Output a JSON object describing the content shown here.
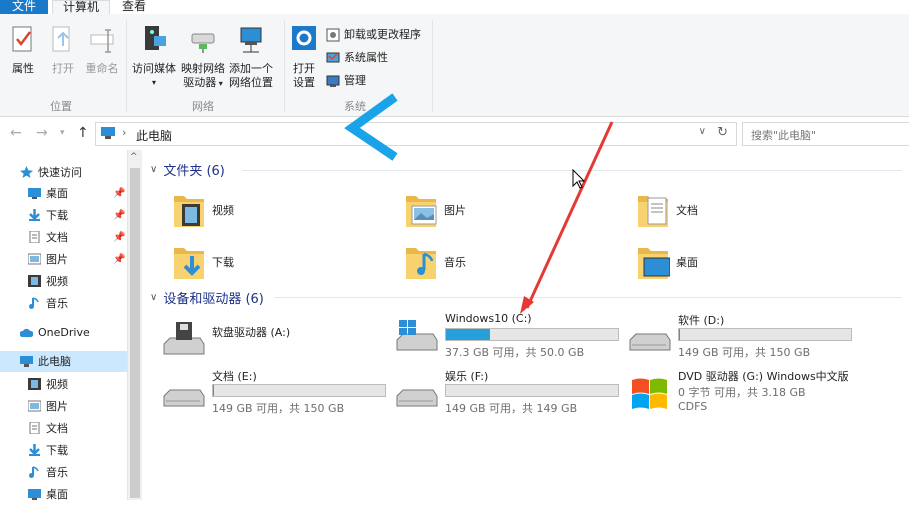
{
  "tabs": {
    "file": "文件",
    "computer": "计算机",
    "view": "查看"
  },
  "ribbon": {
    "properties": "属性",
    "open": "打开",
    "rename": "重命名",
    "group_location": "位置",
    "access_media": "访问媒体",
    "map_drive_l1": "映射网络",
    "map_drive_l2": "驱动器",
    "add_location_l1": "添加一个",
    "add_location_l2": "网络位置",
    "group_network": "网络",
    "open_settings_l1": "打开",
    "open_settings_l2": "设置",
    "uninstall": "卸载或更改程序",
    "system_props": "系统属性",
    "manage": "管理",
    "group_system": "系统"
  },
  "address": {
    "path": "此电脑",
    "search_placeholder": "搜索\"此电脑\""
  },
  "sidebar": [
    {
      "label": "快速访问",
      "icon": "star-icon",
      "pin": false
    },
    {
      "label": "桌面",
      "icon": "desktop-icon",
      "pin": true
    },
    {
      "label": "下载",
      "icon": "download-icon",
      "pin": true
    },
    {
      "label": "文档",
      "icon": "document-icon",
      "pin": true
    },
    {
      "label": "图片",
      "icon": "picture-icon",
      "pin": true
    },
    {
      "label": "视频",
      "icon": "video-icon",
      "pin": false
    },
    {
      "label": "音乐",
      "icon": "music-icon",
      "pin": false
    },
    {
      "label": "OneDrive",
      "icon": "cloud-icon",
      "pin": false
    },
    {
      "label": "此电脑",
      "icon": "pc-icon",
      "pin": false
    },
    {
      "label": "视频",
      "icon": "video-icon",
      "pin": false
    },
    {
      "label": "图片",
      "icon": "picture-icon",
      "pin": false
    },
    {
      "label": "文档",
      "icon": "document-icon",
      "pin": false
    },
    {
      "label": "下载",
      "icon": "download-icon",
      "pin": false
    },
    {
      "label": "音乐",
      "icon": "music-icon",
      "pin": false
    },
    {
      "label": "桌面",
      "icon": "desktop-icon",
      "pin": false
    }
  ],
  "folders_header": "文件夹 (6)",
  "folders": [
    {
      "label": "视频",
      "icon": "video-folder-icon"
    },
    {
      "label": "图片",
      "icon": "picture-folder-icon"
    },
    {
      "label": "文档",
      "icon": "document-folder-icon"
    },
    {
      "label": "下载",
      "icon": "download-folder-icon"
    },
    {
      "label": "音乐",
      "icon": "music-folder-icon"
    },
    {
      "label": "桌面",
      "icon": "desktop-folder-icon"
    }
  ],
  "drives_header": "设备和驱动器 (6)",
  "drives": [
    {
      "name": "软盘驱动器 (A:)",
      "stat": "",
      "fs": "",
      "used": null,
      "icon": "floppy-drive-icon"
    },
    {
      "name": "Windows10 (C:)",
      "stat": "37.3 GB 可用，共 50.0 GB",
      "fs": "",
      "used": 0.254,
      "icon": "windows-drive-icon"
    },
    {
      "name": "软件 (D:)",
      "stat": "149 GB 可用，共 150 GB",
      "fs": "",
      "used": 0.007,
      "icon": "hard-drive-icon"
    },
    {
      "name": "文档 (E:)",
      "stat": "149 GB 可用，共 150 GB",
      "fs": "",
      "used": 0.007,
      "icon": "hard-drive-icon"
    },
    {
      "name": "娱乐 (F:)",
      "stat": "149 GB 可用，共 149 GB",
      "fs": "",
      "used": 0.0,
      "icon": "hard-drive-icon"
    },
    {
      "name": "DVD 驱动器 (G:) Windows中文版",
      "stat": "0 字节 可用，共 3.18 GB",
      "fs": "CDFS",
      "used": null,
      "icon": "dvd-drive-icon"
    }
  ],
  "colors": {
    "accent": "#1979ca",
    "arrow": "#e53935",
    "chevron": "#1aa3e8"
  }
}
